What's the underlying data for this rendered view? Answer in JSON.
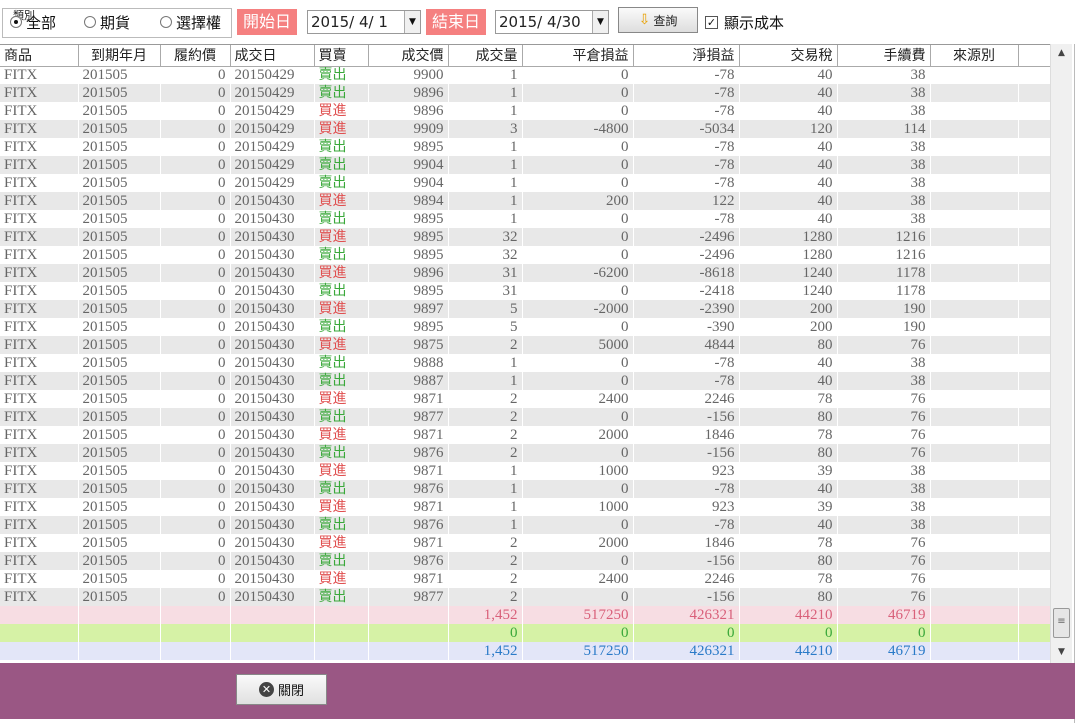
{
  "filter": {
    "legend": "類別",
    "radios": [
      {
        "label": "全部",
        "checked": true
      },
      {
        "label": "期貨",
        "checked": false
      },
      {
        "label": "選擇權",
        "checked": false
      }
    ]
  },
  "start": {
    "label": "開始日",
    "value": "2015/  4/  1"
  },
  "end": {
    "label": "結束日",
    "value": "2015/  4/30"
  },
  "query_label": "查詢",
  "show_cost": {
    "label": "顯示成本",
    "checked": true
  },
  "columns": [
    "商品",
    "到期年月",
    "履約價",
    "成交日",
    "買賣",
    "成交價",
    "成交量",
    "平倉損益",
    "淨損益",
    "交易稅",
    "手續費",
    "來源別"
  ],
  "rows": [
    [
      "FITX",
      "201505",
      "0",
      "20150429",
      "賣出",
      "9900",
      "1",
      "0",
      "-78",
      "40",
      "38",
      ""
    ],
    [
      "FITX",
      "201505",
      "0",
      "20150429",
      "賣出",
      "9896",
      "1",
      "0",
      "-78",
      "40",
      "38",
      ""
    ],
    [
      "FITX",
      "201505",
      "0",
      "20150429",
      "買進",
      "9896",
      "1",
      "0",
      "-78",
      "40",
      "38",
      ""
    ],
    [
      "FITX",
      "201505",
      "0",
      "20150429",
      "買進",
      "9909",
      "3",
      "-4800",
      "-5034",
      "120",
      "114",
      ""
    ],
    [
      "FITX",
      "201505",
      "0",
      "20150429",
      "賣出",
      "9895",
      "1",
      "0",
      "-78",
      "40",
      "38",
      ""
    ],
    [
      "FITX",
      "201505",
      "0",
      "20150429",
      "賣出",
      "9904",
      "1",
      "0",
      "-78",
      "40",
      "38",
      ""
    ],
    [
      "FITX",
      "201505",
      "0",
      "20150429",
      "賣出",
      "9904",
      "1",
      "0",
      "-78",
      "40",
      "38",
      ""
    ],
    [
      "FITX",
      "201505",
      "0",
      "20150430",
      "買進",
      "9894",
      "1",
      "200",
      "122",
      "40",
      "38",
      ""
    ],
    [
      "FITX",
      "201505",
      "0",
      "20150430",
      "賣出",
      "9895",
      "1",
      "0",
      "-78",
      "40",
      "38",
      ""
    ],
    [
      "FITX",
      "201505",
      "0",
      "20150430",
      "買進",
      "9895",
      "32",
      "0",
      "-2496",
      "1280",
      "1216",
      ""
    ],
    [
      "FITX",
      "201505",
      "0",
      "20150430",
      "賣出",
      "9895",
      "32",
      "0",
      "-2496",
      "1280",
      "1216",
      ""
    ],
    [
      "FITX",
      "201505",
      "0",
      "20150430",
      "買進",
      "9896",
      "31",
      "-6200",
      "-8618",
      "1240",
      "1178",
      ""
    ],
    [
      "FITX",
      "201505",
      "0",
      "20150430",
      "賣出",
      "9895",
      "31",
      "0",
      "-2418",
      "1240",
      "1178",
      ""
    ],
    [
      "FITX",
      "201505",
      "0",
      "20150430",
      "買進",
      "9897",
      "5",
      "-2000",
      "-2390",
      "200",
      "190",
      ""
    ],
    [
      "FITX",
      "201505",
      "0",
      "20150430",
      "賣出",
      "9895",
      "5",
      "0",
      "-390",
      "200",
      "190",
      ""
    ],
    [
      "FITX",
      "201505",
      "0",
      "20150430",
      "買進",
      "9875",
      "2",
      "5000",
      "4844",
      "80",
      "76",
      ""
    ],
    [
      "FITX",
      "201505",
      "0",
      "20150430",
      "賣出",
      "9888",
      "1",
      "0",
      "-78",
      "40",
      "38",
      ""
    ],
    [
      "FITX",
      "201505",
      "0",
      "20150430",
      "賣出",
      "9887",
      "1",
      "0",
      "-78",
      "40",
      "38",
      ""
    ],
    [
      "FITX",
      "201505",
      "0",
      "20150430",
      "買進",
      "9871",
      "2",
      "2400",
      "2246",
      "78",
      "76",
      ""
    ],
    [
      "FITX",
      "201505",
      "0",
      "20150430",
      "賣出",
      "9877",
      "2",
      "0",
      "-156",
      "80",
      "76",
      ""
    ],
    [
      "FITX",
      "201505",
      "0",
      "20150430",
      "買進",
      "9871",
      "2",
      "2000",
      "1846",
      "78",
      "76",
      ""
    ],
    [
      "FITX",
      "201505",
      "0",
      "20150430",
      "賣出",
      "9876",
      "2",
      "0",
      "-156",
      "80",
      "76",
      ""
    ],
    [
      "FITX",
      "201505",
      "0",
      "20150430",
      "買進",
      "9871",
      "1",
      "1000",
      "923",
      "39",
      "38",
      ""
    ],
    [
      "FITX",
      "201505",
      "0",
      "20150430",
      "賣出",
      "9876",
      "1",
      "0",
      "-78",
      "40",
      "38",
      ""
    ],
    [
      "FITX",
      "201505",
      "0",
      "20150430",
      "買進",
      "9871",
      "1",
      "1000",
      "923",
      "39",
      "38",
      ""
    ],
    [
      "FITX",
      "201505",
      "0",
      "20150430",
      "賣出",
      "9876",
      "1",
      "0",
      "-78",
      "40",
      "38",
      ""
    ],
    [
      "FITX",
      "201505",
      "0",
      "20150430",
      "買進",
      "9871",
      "2",
      "2000",
      "1846",
      "78",
      "76",
      ""
    ],
    [
      "FITX",
      "201505",
      "0",
      "20150430",
      "賣出",
      "9876",
      "2",
      "0",
      "-156",
      "80",
      "76",
      ""
    ],
    [
      "FITX",
      "201505",
      "0",
      "20150430",
      "買進",
      "9871",
      "2",
      "2400",
      "2246",
      "78",
      "76",
      ""
    ],
    [
      "FITX",
      "201505",
      "0",
      "20150430",
      "賣出",
      "9877",
      "2",
      "0",
      "-156",
      "80",
      "76",
      ""
    ]
  ],
  "totals": [
    {
      "volume": "1,452",
      "close_pnl": "517250",
      "net_pnl": "426321",
      "tax": "44210",
      "fee": "46719"
    },
    {
      "volume": "0",
      "close_pnl": "0",
      "net_pnl": "0",
      "tax": "0",
      "fee": "0"
    },
    {
      "volume": "1,452",
      "close_pnl": "517250",
      "net_pnl": "426321",
      "tax": "44210",
      "fee": "46719"
    }
  ],
  "close_label": "關閉",
  "colors": {
    "sell": "#3aa83a",
    "buy": "#e05050",
    "footer": "#9a5784",
    "date_label": "#f58080"
  }
}
